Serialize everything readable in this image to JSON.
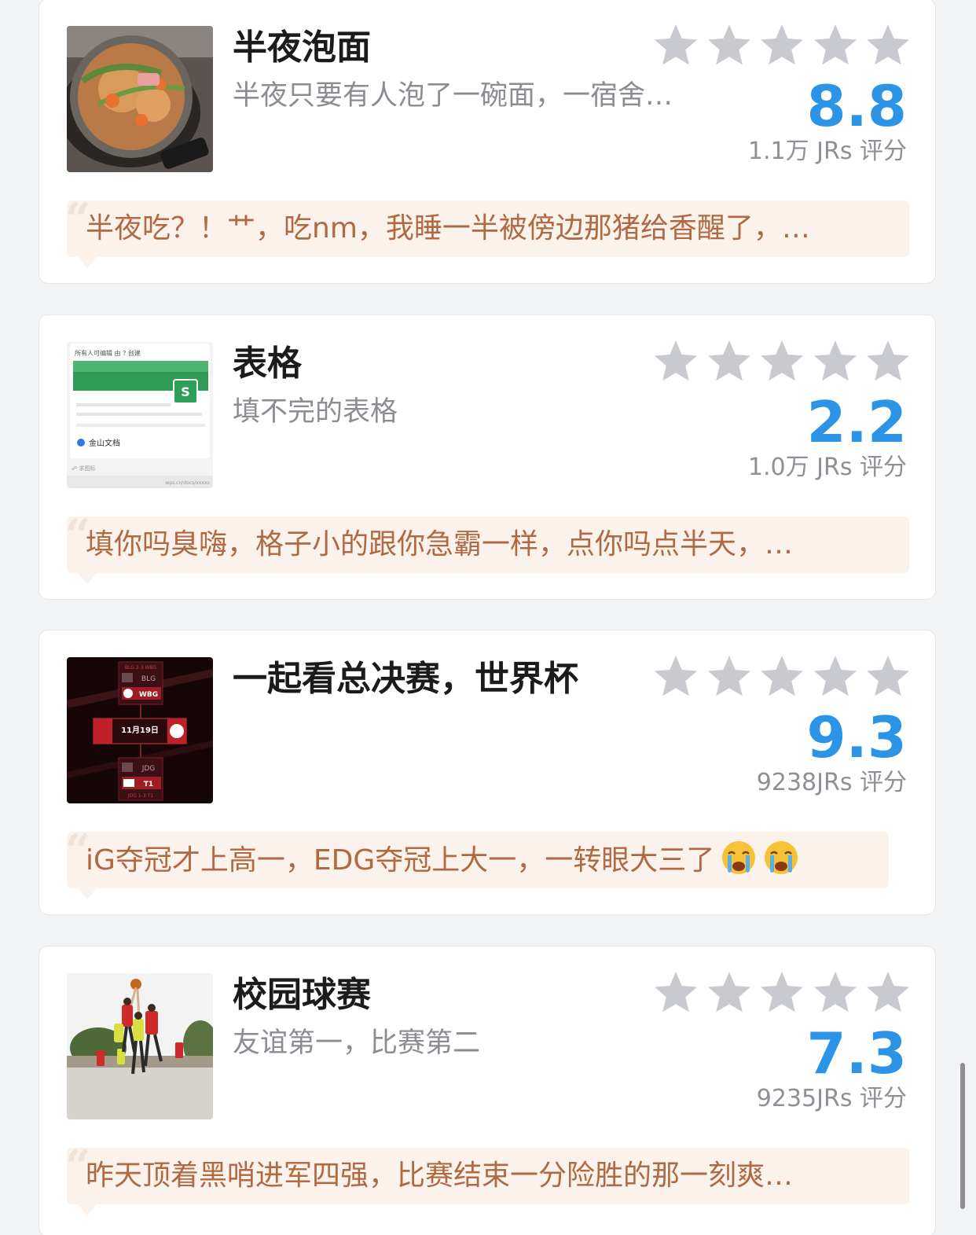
{
  "feed": {
    "items": [
      {
        "title": "半夜泡面",
        "subtitle": "半夜只要有人泡了一碗面，一宿舍…",
        "score": "8.8",
        "rating_count": "1.1万 JRs 评分",
        "quote": "半夜吃？！艹，吃nm，我睡一半被傍边那猪给香醒了，…",
        "thumbnail": "instant-noodle-pot-photo"
      },
      {
        "title": "表格",
        "subtitle": "填不完的表格",
        "score": "2.2",
        "rating_count": "1.0万 JRs 评分",
        "quote": "填你吗臭嗨，格子小的跟你急霸一样，点你吗点半天，…",
        "thumbnail": "spreadsheet-doc-preview",
        "thumb_text": {
          "header": "所有人可编辑  由 ? 创建",
          "app": "金山文档",
          "badge": "S",
          "footer_left": "☍ 求图标",
          "footer_right": "wps.cn/docs/xxxxx"
        }
      },
      {
        "title": "一起看总决赛，世界杯",
        "subtitle": "",
        "score": "9.3",
        "rating_count": "9238JRs 评分",
        "quote": "iG夺冠才上高一，EDG夺冠上大一，一转眼大三了",
        "quote_emojis": [
          "crying-face-icon",
          "crying-face-icon"
        ],
        "thumbnail": "worlds-bracket-graphic",
        "thumb_text": {
          "top_score": "BLG 2-3 WBG",
          "team1": "BLG",
          "team2": "WBG",
          "date": "11月19日",
          "team3": "JDG",
          "team4": "T1",
          "bottom_score": "JDG 1-3 T1"
        }
      },
      {
        "title": "校园球赛",
        "subtitle": "友谊第一，比赛第二",
        "score": "7.3",
        "rating_count": "9235JRs 评分",
        "quote": "昨天顶着黑哨进军四强，比赛结束一分险胜的那一刻爽…",
        "thumbnail": "campus-basketball-photo"
      }
    ]
  },
  "style": {
    "accent": "#2c94e6",
    "star_color": "#c9cad0",
    "quote_bg": "#fbf2ec",
    "quote_text": "#b06a43"
  }
}
